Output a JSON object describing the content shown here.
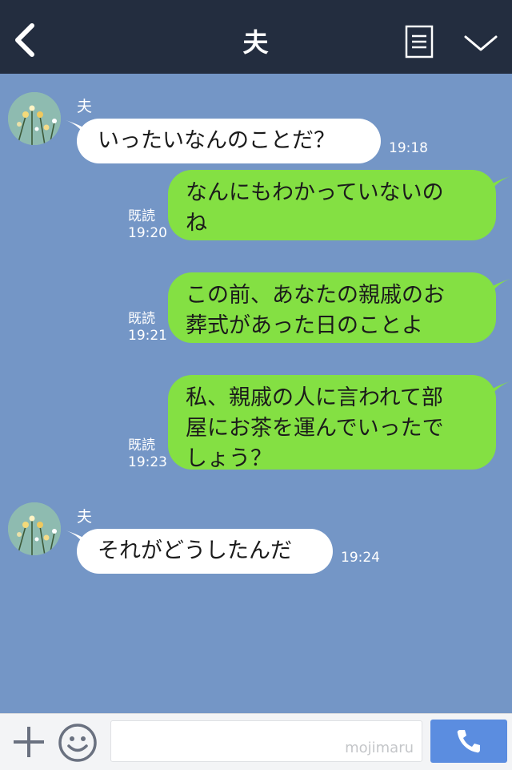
{
  "header": {
    "title": "夫"
  },
  "messages": [
    {
      "sender": "夫",
      "text": "いったいなんのことだ？",
      "time": "19:18"
    },
    {
      "read": "既読",
      "time": "19:20",
      "lines": [
        "なんにもわかっていないの",
        "ね"
      ]
    },
    {
      "read": "既読",
      "time": "19:21",
      "lines": [
        "この前、あなたの親戚のお",
        "葬式があった日のことよ"
      ]
    },
    {
      "read": "既読",
      "time": "19:23",
      "lines": [
        "私、親戚の人に言われて部",
        "屋にお茶を運んでいったで",
        "しょう？"
      ]
    },
    {
      "sender": "夫",
      "text": "それがどうしたんだ",
      "time": "19:24"
    }
  ],
  "footer": {
    "watermark": "mojimaru"
  },
  "colors": {
    "header_bg": "#232d3f",
    "chat_bg": "#7496c6",
    "incoming_bubble": "#ffffff",
    "outgoing_bubble": "#84e043",
    "call_button": "#5b8de0"
  },
  "icons": [
    "back-arrow-icon",
    "menu-icon",
    "chevron-down-icon",
    "plus-icon",
    "smile-icon",
    "phone-icon"
  ]
}
